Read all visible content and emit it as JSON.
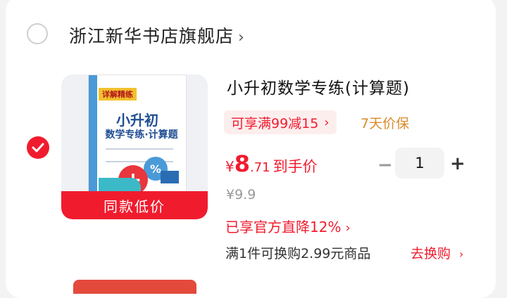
{
  "store": {
    "name": "浙江新华书店旗舰店",
    "chevron": "›"
  },
  "product": {
    "title": "小升初数学专练(计算题)",
    "thumbnail": {
      "cover_tag": "详解精练",
      "cover_title": "小升初",
      "cover_subtitle": "数学专练·计算题",
      "cover_symbol": "%",
      "cover_plus": "+",
      "badge": "同款低价"
    },
    "promo_label": "可享满99减15",
    "promo_chevron": "›",
    "guarantee_label": "7天价保",
    "price_symbol": "¥",
    "price_integer": "8",
    "price_decimal": ".71",
    "price_label": "到手价",
    "original_price": "¥9.9",
    "discount_label": "已享官方直降12%",
    "discount_chevron": "›",
    "quantity": "1",
    "minus_symbol": "−",
    "plus_symbol": "+",
    "addon_text": "满1件可换购2.99元商品",
    "addon_link": "去换购",
    "addon_chevron": "›",
    "selected": true
  },
  "colors": {
    "accent": "#f01c2e",
    "guarantee": "#d98a2a",
    "promo_bg": "#fdeeee"
  }
}
